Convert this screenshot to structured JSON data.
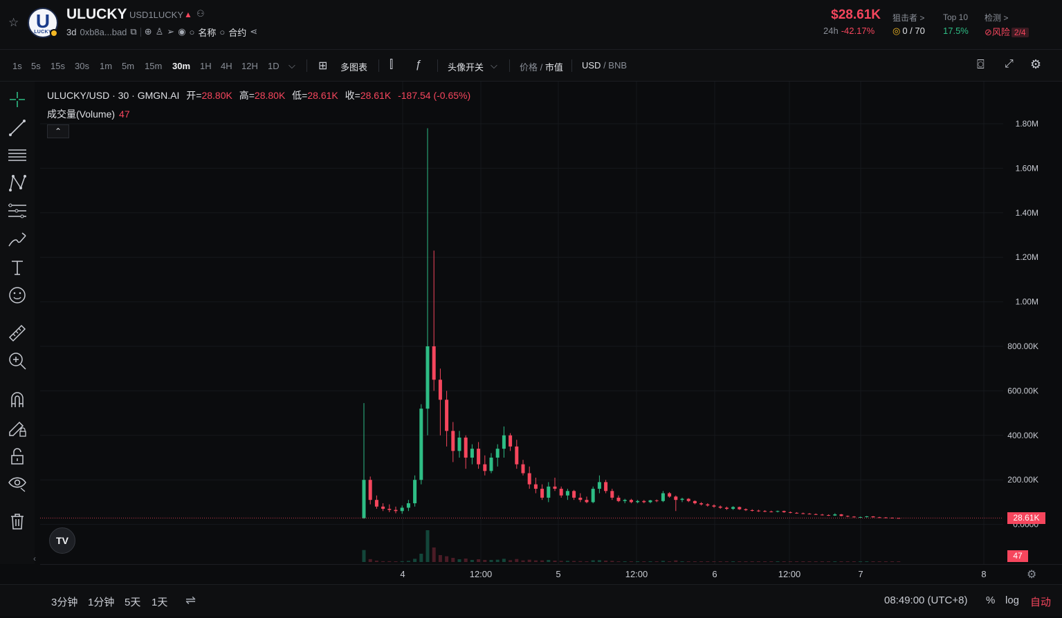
{
  "header": {
    "token_name": "ULUCKY",
    "token_symbol": "USD1LUCKY",
    "logo_text": "U",
    "logo_sub": "LUCKY",
    "age": "3d",
    "address": "0xb8a...bad",
    "name_search": "名称",
    "contract_search": "合约",
    "price": "$28.61K",
    "change_label": "24h",
    "change_value": "-42.17%",
    "snipers_label": "狙击者 >",
    "snipers_value": "0 / 70",
    "top10_label": "Top 10",
    "top10_value": "17.5%",
    "check_label": "检测 >",
    "risk_label": "风险",
    "risk_value": "2/4"
  },
  "toolbar": {
    "timeframes": [
      "1s",
      "5s",
      "15s",
      "30s",
      "1m",
      "5m",
      "15m",
      "30m",
      "1H",
      "4H",
      "12H",
      "1D"
    ],
    "active_timeframe": "30m",
    "multi_chart": "多图表",
    "avatar_toggle": "头像开关",
    "price_label": "价格",
    "mcap_label": "市值",
    "usd_label": "USD",
    "bnb_label": "BNB"
  },
  "chart": {
    "legend_title": "ULUCKY/USD · 30 · GMGN.AI",
    "open_label": "开=",
    "open_value": "28.80K",
    "high_label": "高=",
    "high_value": "28.80K",
    "low_label": "低=",
    "low_value": "28.61K",
    "close_label": "收=",
    "close_value": "28.61K",
    "change_text": "-187.54 (-0.65%)",
    "volume_label": "成交量(Volume)",
    "volume_value": "47",
    "tv_logo": "TV",
    "current_price_tag": "28.61K",
    "volume_tag": "47",
    "y_axis_labels": [
      "1.80M",
      "1.60M",
      "1.40M",
      "1.20M",
      "1.00M",
      "800.00K",
      "600.00K",
      "400.00K",
      "200.00K",
      "0.0000"
    ],
    "x_axis_labels": [
      "4",
      "12:00",
      "5",
      "12:00",
      "6",
      "12:00",
      "7",
      "8"
    ]
  },
  "bottom": {
    "range_3m": "3分钟",
    "range_1m": "1分钟",
    "range_5d": "5天",
    "range_1d": "1天",
    "time": "08:49:00 (UTC+8)",
    "percent": "%",
    "log": "log",
    "auto": "自动"
  },
  "chart_data": {
    "type": "candlestick",
    "title": "ULUCKY/USD · 30 · GMGN.AI",
    "ylim": [
      0,
      1900000
    ],
    "colors": {
      "up": "#2ebd85",
      "down": "#f6465d"
    },
    "candles": [
      [
        28000,
        545000,
        25000,
        200000
      ],
      [
        200000,
        215000,
        90000,
        110000
      ],
      [
        110000,
        130000,
        70000,
        80000
      ],
      [
        80000,
        95000,
        60000,
        70000
      ],
      [
        70000,
        90000,
        55000,
        65000
      ],
      [
        65000,
        80000,
        50000,
        60000
      ],
      [
        60000,
        85000,
        48000,
        75000
      ],
      [
        75000,
        110000,
        60000,
        95000
      ],
      [
        95000,
        220000,
        80000,
        200000
      ],
      [
        200000,
        540000,
        180000,
        520000
      ],
      [
        520000,
        1780000,
        400000,
        800000
      ],
      [
        800000,
        1230000,
        600000,
        650000
      ],
      [
        650000,
        700000,
        400000,
        560000
      ],
      [
        560000,
        600000,
        350000,
        420000
      ],
      [
        420000,
        460000,
        280000,
        330000
      ],
      [
        330000,
        420000,
        300000,
        390000
      ],
      [
        390000,
        400000,
        250000,
        300000
      ],
      [
        300000,
        360000,
        270000,
        340000
      ],
      [
        340000,
        370000,
        250000,
        270000
      ],
      [
        270000,
        310000,
        220000,
        240000
      ],
      [
        240000,
        320000,
        230000,
        300000
      ],
      [
        300000,
        360000,
        260000,
        340000
      ],
      [
        340000,
        440000,
        300000,
        400000
      ],
      [
        400000,
        410000,
        330000,
        350000
      ],
      [
        350000,
        380000,
        250000,
        270000
      ],
      [
        270000,
        290000,
        220000,
        230000
      ],
      [
        230000,
        260000,
        160000,
        180000
      ],
      [
        180000,
        210000,
        140000,
        160000
      ],
      [
        160000,
        180000,
        110000,
        120000
      ],
      [
        120000,
        190000,
        100000,
        170000
      ],
      [
        170000,
        210000,
        150000,
        160000
      ],
      [
        160000,
        170000,
        120000,
        130000
      ],
      [
        130000,
        160000,
        110000,
        150000
      ],
      [
        150000,
        155000,
        110000,
        120000
      ],
      [
        120000,
        140000,
        100000,
        110000
      ],
      [
        110000,
        125000,
        95000,
        100000
      ],
      [
        100000,
        170000,
        95000,
        160000
      ],
      [
        160000,
        220000,
        140000,
        190000
      ],
      [
        190000,
        200000,
        140000,
        150000
      ],
      [
        150000,
        160000,
        110000,
        120000
      ],
      [
        120000,
        130000,
        100000,
        105000
      ],
      [
        105000,
        115000,
        95000,
        110000
      ],
      [
        110000,
        115000,
        95000,
        100000
      ],
      [
        100000,
        110000,
        95000,
        105000
      ],
      [
        105000,
        110000,
        95000,
        100000
      ],
      [
        100000,
        110000,
        95000,
        108000
      ],
      [
        108000,
        112000,
        100000,
        105000
      ],
      [
        105000,
        150000,
        100000,
        140000
      ],
      [
        140000,
        145000,
        120000,
        125000
      ],
      [
        125000,
        130000,
        60000,
        110000
      ],
      [
        110000,
        120000,
        100000,
        115000
      ],
      [
        115000,
        118000,
        100000,
        105000
      ],
      [
        105000,
        108000,
        90000,
        95000
      ],
      [
        95000,
        100000,
        85000,
        90000
      ],
      [
        90000,
        95000,
        80000,
        85000
      ],
      [
        85000,
        90000,
        75000,
        80000
      ],
      [
        80000,
        85000,
        70000,
        75000
      ],
      [
        75000,
        80000,
        65000,
        70000
      ],
      [
        70000,
        82000,
        65000,
        78000
      ],
      [
        78000,
        80000,
        65000,
        68000
      ],
      [
        68000,
        72000,
        60000,
        64000
      ],
      [
        64000,
        68000,
        58000,
        62000
      ],
      [
        62000,
        66000,
        56000,
        60000
      ],
      [
        60000,
        64000,
        55000,
        58000
      ],
      [
        58000,
        62000,
        54000,
        57000
      ],
      [
        57000,
        62000,
        54000,
        60000
      ],
      [
        60000,
        62000,
        52000,
        55000
      ],
      [
        55000,
        58000,
        50000,
        52000
      ],
      [
        52000,
        55000,
        48000,
        50000
      ],
      [
        50000,
        53000,
        46000,
        48000
      ],
      [
        48000,
        51000,
        45000,
        46000
      ],
      [
        46000,
        49000,
        43000,
        44000
      ],
      [
        44000,
        47000,
        40000,
        42000
      ],
      [
        42000,
        45000,
        38000,
        40000
      ],
      [
        40000,
        50000,
        38000,
        45000
      ],
      [
        45000,
        47000,
        36000,
        38000
      ],
      [
        38000,
        40000,
        33000,
        35000
      ],
      [
        35000,
        37000,
        31000,
        32000
      ],
      [
        32000,
        35000,
        30000,
        33000
      ],
      [
        33000,
        38000,
        31000,
        36000
      ],
      [
        36000,
        37000,
        31000,
        32000
      ],
      [
        32000,
        34000,
        30000,
        31000
      ],
      [
        31000,
        33000,
        29500,
        30000
      ],
      [
        30000,
        31000,
        28700,
        28800
      ],
      [
        28800,
        28800,
        28610,
        28610
      ]
    ],
    "volume": [
      47
    ]
  }
}
